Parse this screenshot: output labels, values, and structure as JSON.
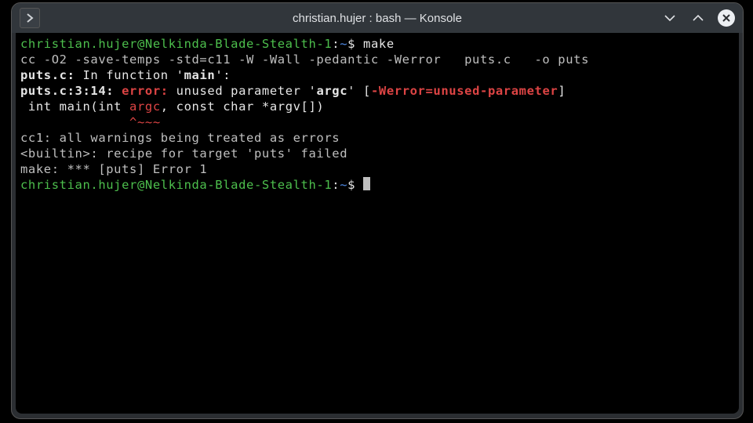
{
  "window": {
    "title": "christian.hujer : bash — Konsole"
  },
  "prompt": {
    "user_host": "christian.hujer@Nelkinda-Blade-Stealth-1",
    "sep": ":",
    "cwd": "~",
    "dollar": "$ "
  },
  "term": {
    "cmd1": "make",
    "cc_line": "cc -O2 -save-temps -std=c11 -W -Wall -pedantic -Werror   puts.c   -o puts",
    "infunc_pre": "puts.c:",
    "infunc_txt": " In function '",
    "infunc_main": "main",
    "infunc_suf": "':",
    "loc": "puts.c:3:14: ",
    "err_word": "error: ",
    "err_msg": "unused parameter '",
    "err_argc": "argc",
    "err_msg2": "' [",
    "werror_flag": "-Werror=unused-parameter",
    "err_close": "]",
    "src_pre": " int main(int ",
    "src_argc": "argc",
    "src_post": ", const char *argv[])",
    "caret_pad": "              ",
    "caret": "^~~~",
    "cc1": "cc1: all warnings being treated as errors",
    "builtin": "<builtin>: recipe for target 'puts' failed",
    "make_err": "make: *** [puts] Error 1"
  }
}
